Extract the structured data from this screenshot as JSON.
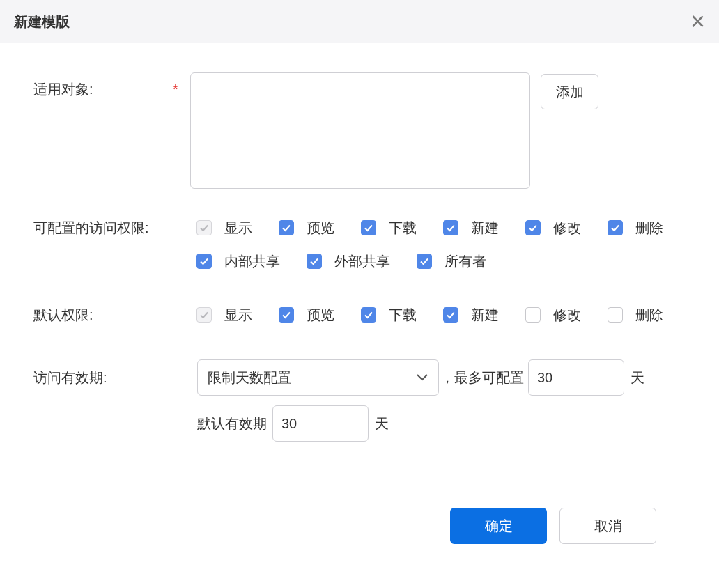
{
  "dialog": {
    "title": "新建模版",
    "close": "×"
  },
  "target": {
    "label": "适用对象:",
    "required_mark": "*",
    "add_button": "添加"
  },
  "configurable": {
    "label": "可配置的访问权限:",
    "options": [
      {
        "label": "显示",
        "checked": true,
        "disabled": true
      },
      {
        "label": "预览",
        "checked": true,
        "disabled": false
      },
      {
        "label": "下载",
        "checked": true,
        "disabled": false
      },
      {
        "label": "新建",
        "checked": true,
        "disabled": false
      },
      {
        "label": "修改",
        "checked": true,
        "disabled": false
      },
      {
        "label": "删除",
        "checked": true,
        "disabled": false
      },
      {
        "label": "内部共享",
        "checked": true,
        "disabled": false
      },
      {
        "label": "外部共享",
        "checked": true,
        "disabled": false
      },
      {
        "label": "所有者",
        "checked": true,
        "disabled": false
      }
    ]
  },
  "default_permissions": {
    "label": "默认权限:",
    "options": [
      {
        "label": "显示",
        "checked": true,
        "disabled": true
      },
      {
        "label": "预览",
        "checked": true,
        "disabled": false
      },
      {
        "label": "下载",
        "checked": true,
        "disabled": false
      },
      {
        "label": "新建",
        "checked": true,
        "disabled": false
      },
      {
        "label": "修改",
        "checked": false,
        "disabled": false
      },
      {
        "label": "删除",
        "checked": false,
        "disabled": false
      }
    ]
  },
  "validity": {
    "label": "访问有效期:",
    "select_value": "限制天数配置",
    "max_prefix": "，最多可配置",
    "max_value": "30",
    "max_unit": "天",
    "default_label": "默认有效期",
    "default_value": "30",
    "default_unit": "天"
  },
  "buttons": [
    {
      "label": "确定",
      "kind": "primary"
    },
    {
      "label": "取消",
      "kind": "secondary"
    }
  ]
}
